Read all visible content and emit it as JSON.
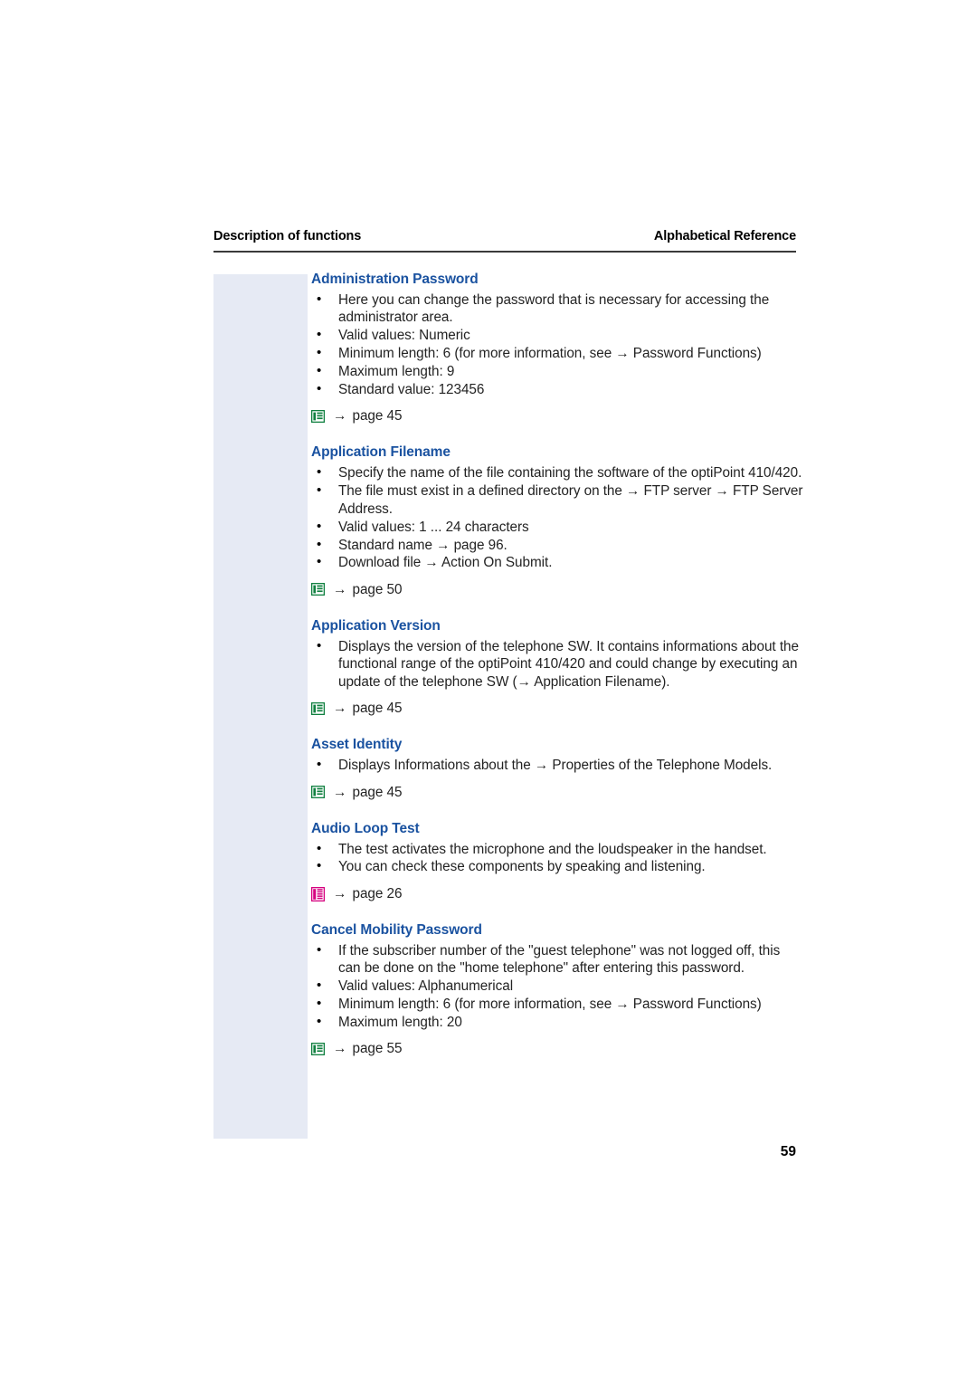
{
  "running_head": {
    "left": "Description of functions",
    "right": "Alphabetical Reference"
  },
  "folio": "59",
  "colors": {
    "heading_blue": "#1a52a0",
    "side_band": "#e6eaf4",
    "icon_green": "#108040",
    "icon_magenta": "#d6007f",
    "rule": "#3a3a3a"
  },
  "entries": [
    {
      "title": "Administration Password",
      "bullets": [
        "Here you can change the password that is necessary for accessing the administrator area.",
        "Valid values: Numeric",
        "Minimum length: 6 (for more information, see → Password Functions)",
        "Maximum length: 9",
        "Standard value: 123456"
      ],
      "reference": {
        "icon": "web-page-icon",
        "icon_color": "#108040",
        "arrow": "→",
        "text": "page 45"
      }
    },
    {
      "title": "Application Filename",
      "bullets": [
        "Specify the name of the file containing the software of the optiPoint 410/420.",
        "The file must exist in a defined directory on the → FTP server → FTP Server Address.",
        "Valid values: 1 ... 24 characters",
        "Standard name → page 96.",
        "Download file → Action On Submit."
      ],
      "reference": {
        "icon": "web-page-icon",
        "icon_color": "#108040",
        "arrow": "→",
        "text": "page 50"
      }
    },
    {
      "title": "Application Version",
      "bullets": [
        "Displays the version of the telephone SW. It contains informations about the functional range of the optiPoint 410/420 and could change by executing an update of the telephone SW (→ Application Filename)."
      ],
      "reference": {
        "icon": "web-page-icon",
        "icon_color": "#108040",
        "arrow": "→",
        "text": "page 45"
      }
    },
    {
      "title": "Asset Identity",
      "bullets": [
        "Displays Informations about the → Properties of the Telephone Models."
      ],
      "reference": {
        "icon": "web-page-icon",
        "icon_color": "#108040",
        "arrow": "→",
        "text": "page 45"
      }
    },
    {
      "title": "Audio Loop Test",
      "bullets": [
        "The test activates the microphone and the loudspeaker in the handset.",
        "You can check these components by speaking and listening."
      ],
      "reference": {
        "icon": "telephone-menu-icon",
        "icon_color": "#d6007f",
        "arrow": "→",
        "text": "page 26"
      }
    },
    {
      "title": "Cancel Mobility Password",
      "bullets": [
        "If the subscriber number of the \"guest telephone\" was not logged off, this can be done on the \"home telephone\" after entering this password.",
        "Valid values: Alphanumerical",
        "Minimum length: 6 (for more information, see → Password Functions)",
        "Maximum length: 20"
      ],
      "reference": {
        "icon": "web-page-icon",
        "icon_color": "#108040",
        "arrow": "→",
        "text": "page 55"
      }
    }
  ]
}
